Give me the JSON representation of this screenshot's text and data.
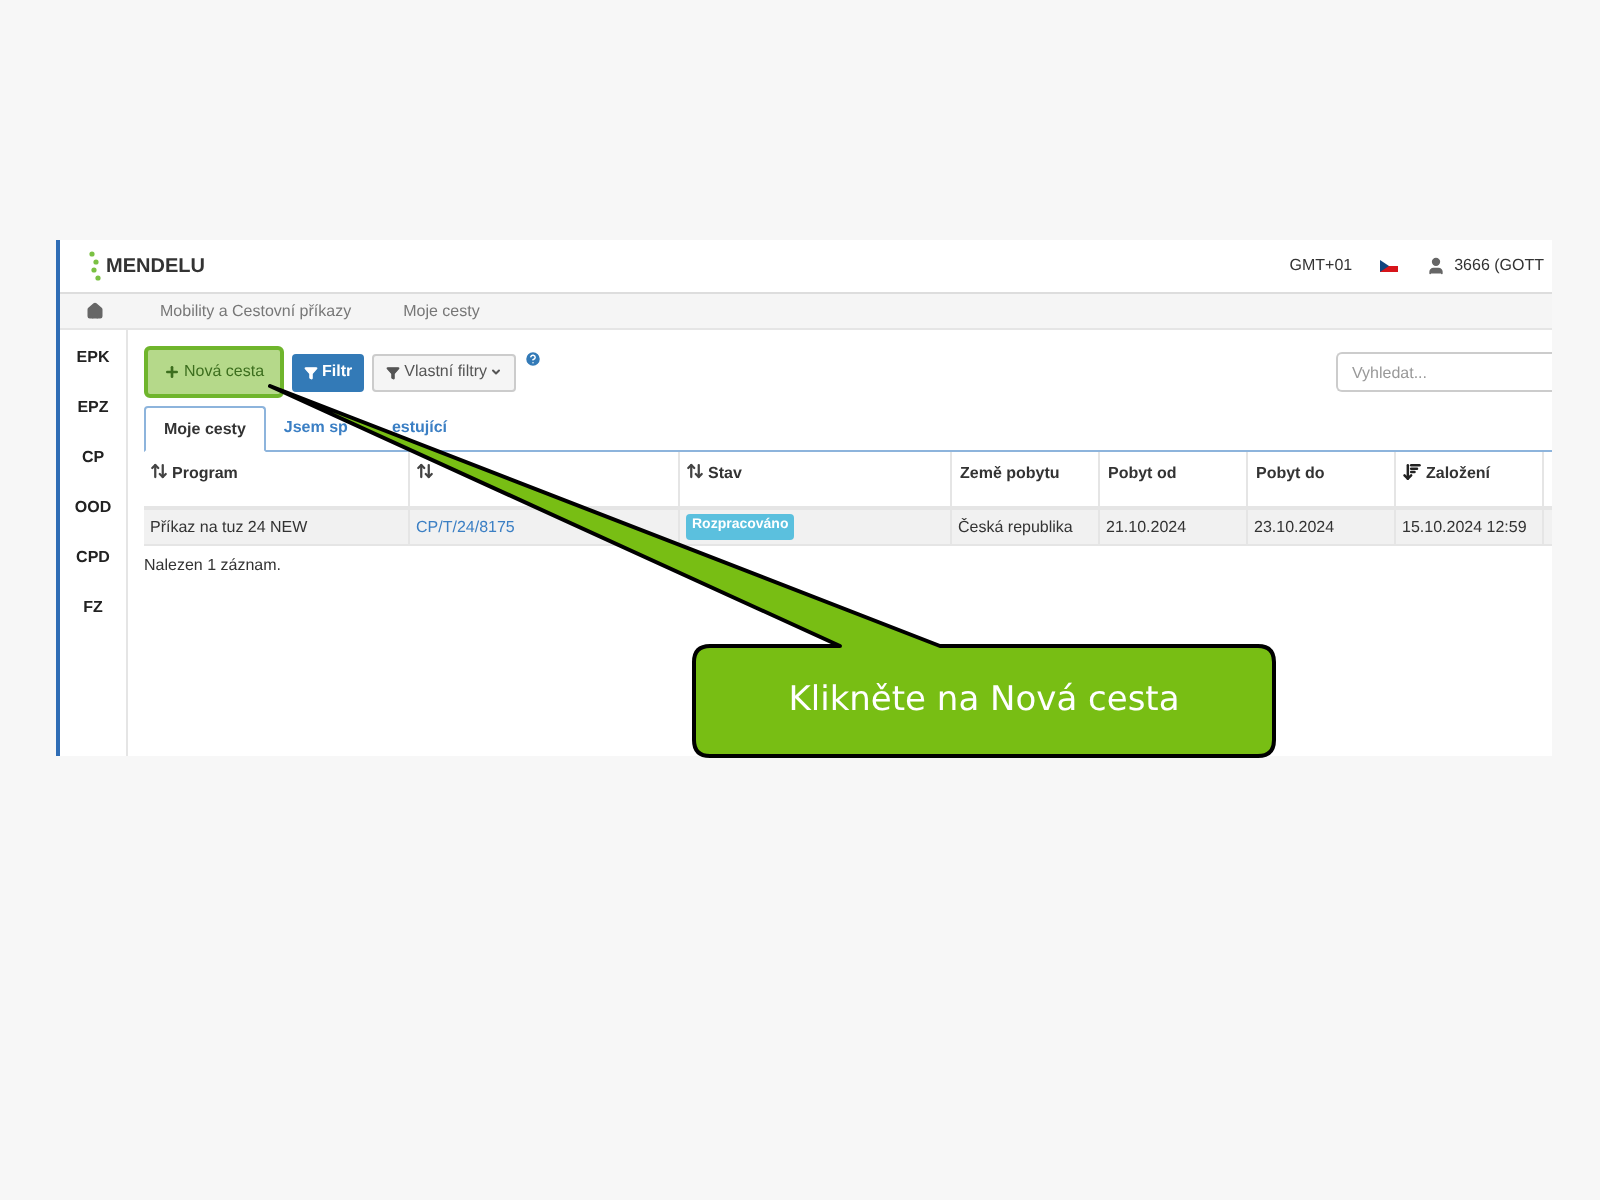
{
  "header": {
    "logo": "MENDELU",
    "timezone": "GMT+01",
    "user": "3666 (GOTT"
  },
  "breadcrumbs": [
    "Mobility a Cestovní příkazy",
    "Moje cesty"
  ],
  "sidebar": {
    "items": [
      "EPK",
      "EPZ",
      "CP",
      "OOD",
      "CPD",
      "FZ"
    ]
  },
  "toolbar": {
    "new_button": "Nová cesta",
    "new_button_highlighted": true,
    "filter_button": "Filtr",
    "custom_filters": "Vlastní filtry",
    "search": {
      "placeholder": "Vyhledat..."
    }
  },
  "tabs": [
    {
      "label": "Moje cesty",
      "selected": true
    },
    {
      "label_parts": [
        "Jsem sp",
        "estující"
      ],
      "selected": false
    }
  ],
  "table": {
    "columns": [
      {
        "label": "Program",
        "sortable": true,
        "sorted": false
      },
      {
        "sortable": true,
        "sorted": false
      },
      {
        "label": "Stav",
        "sortable": true,
        "sorted": false
      },
      {
        "label": "Země pobytu",
        "sortable": false,
        "sorted": false
      },
      {
        "label": "Pobyt od",
        "sortable": false,
        "sorted": false
      },
      {
        "label": "Pobyt do",
        "sortable": false,
        "sorted": false
      },
      {
        "label": "Založení",
        "sortable": true,
        "sorted": true
      }
    ],
    "rows": [
      [
        {
          "kind": "text",
          "text": "Příkaz na tuz 24 NEW"
        },
        {
          "kind": "link",
          "text": "CP/T/24/8175"
        },
        {
          "kind": "badge",
          "text": "Rozpracováno"
        },
        {
          "kind": "text",
          "text": "Česká republika"
        },
        {
          "kind": "text",
          "text": "21.10.2024"
        },
        {
          "kind": "text",
          "text": "23.10.2024"
        },
        {
          "kind": "text",
          "text": "15.10.2024 12:59"
        }
      ]
    ]
  },
  "result_count": "Nalezen 1 záznam.",
  "callout": {
    "text": "Klikněte na Nová cesta"
  }
}
